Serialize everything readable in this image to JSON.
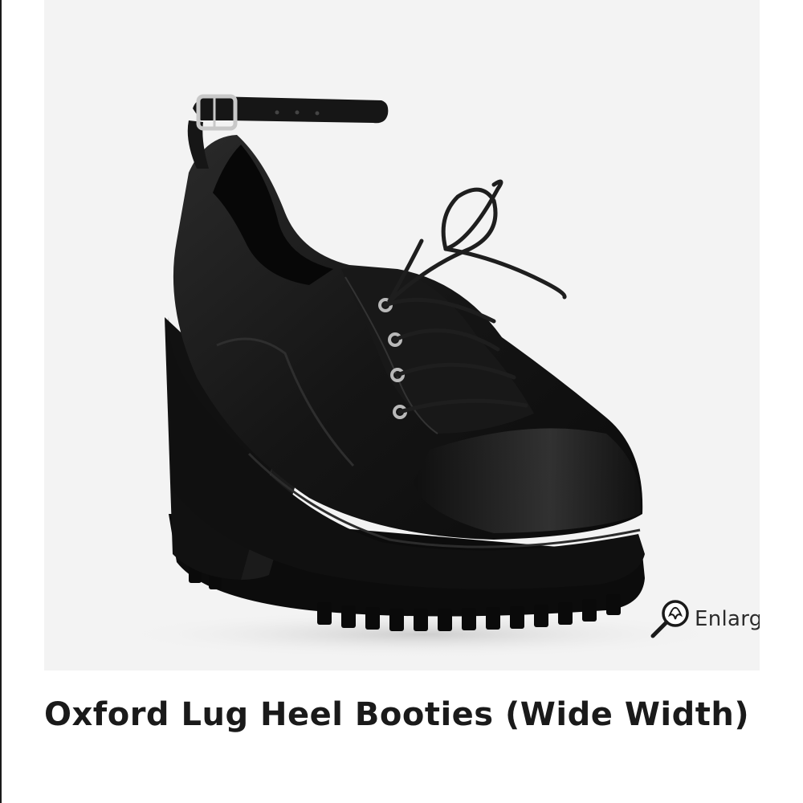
{
  "product": {
    "title": "Oxford Lug Heel Booties (Wide Width)",
    "image_alt": "Black lace-up oxford booties with ankle strap and chunky lug heel"
  },
  "gallery": {
    "next_icon": "chevron-right-icon",
    "enlarge_label": "Enlarge",
    "enlarge_icon": "magnifier-icon"
  },
  "colors": {
    "image_background": "#f3f3f3",
    "shoe": "#141414",
    "text": "#1a1a1a"
  }
}
